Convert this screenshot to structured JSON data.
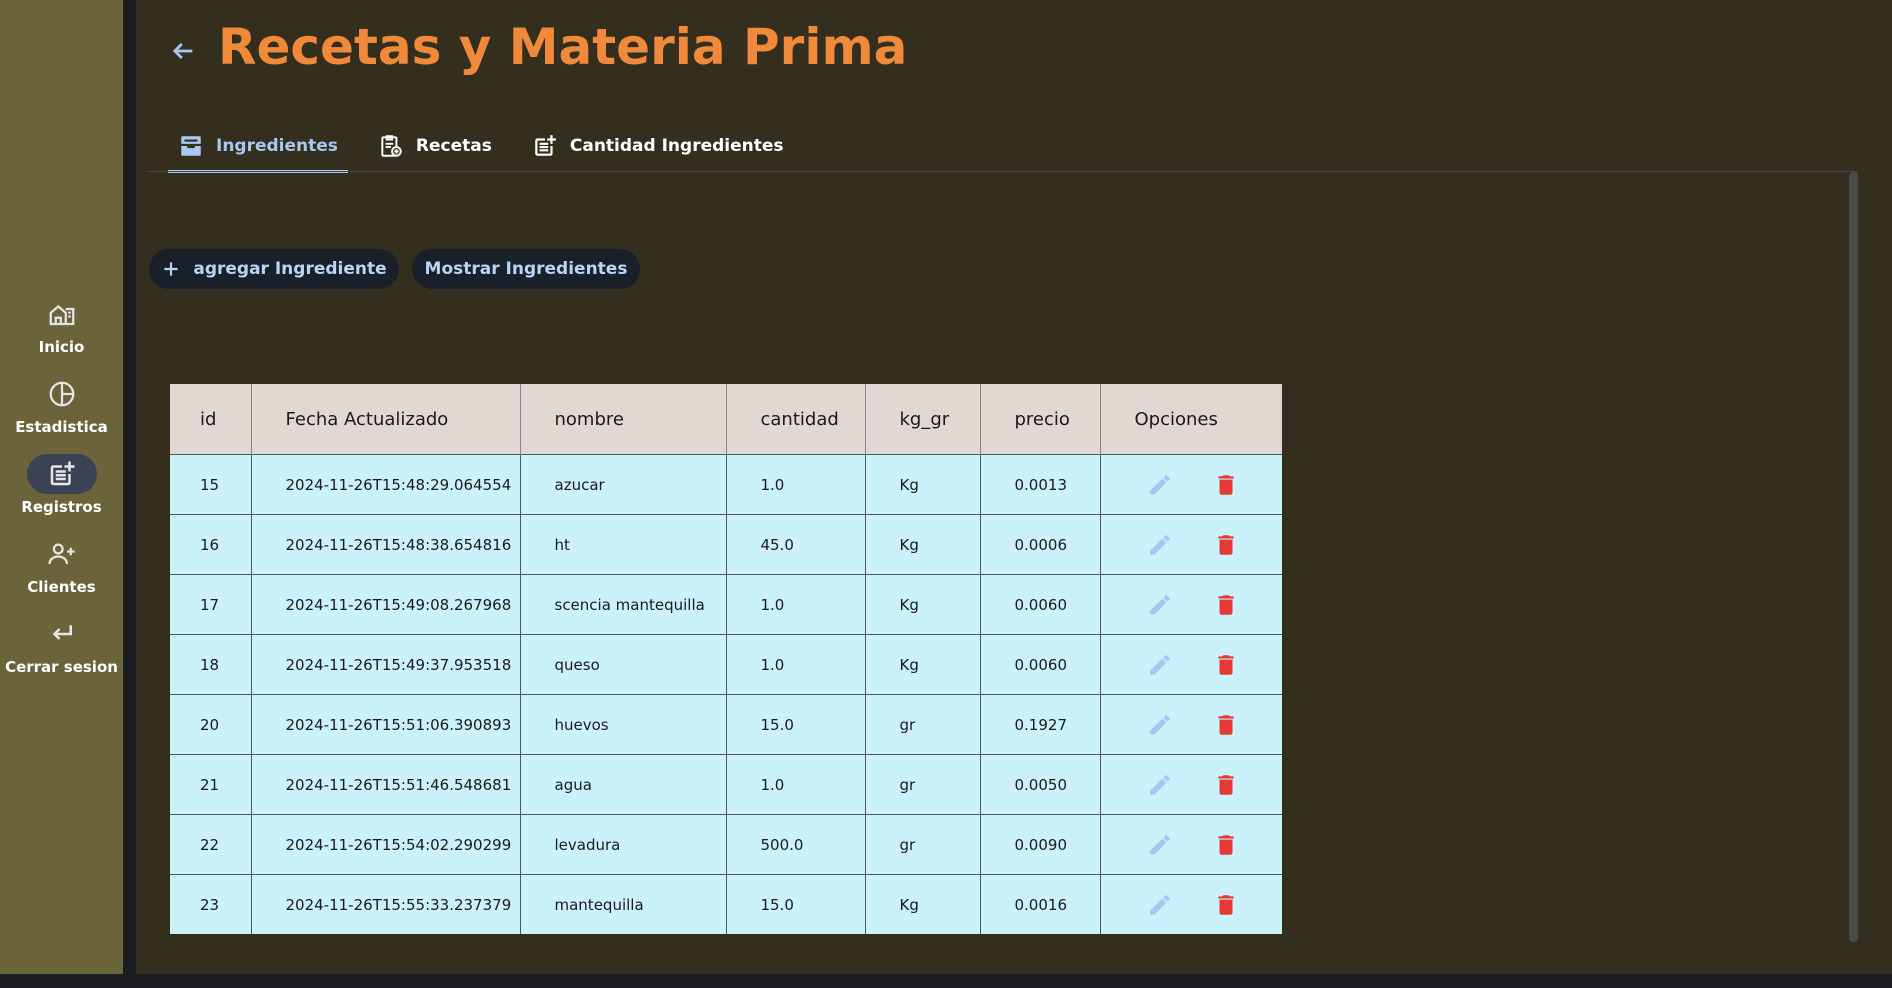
{
  "nav": {
    "items": [
      {
        "label": "Inicio",
        "icon": "home-icon"
      },
      {
        "label": "Estadistica",
        "icon": "pie-chart-icon"
      },
      {
        "label": "Registros",
        "icon": "post-add-icon",
        "active": true
      },
      {
        "label": "Clientes",
        "icon": "person-add-icon"
      },
      {
        "label": "Cerrar sesion",
        "icon": "logout-icon"
      }
    ]
  },
  "header": {
    "title": "Recetas y Materia Prima"
  },
  "tabs": [
    {
      "label": "Ingredientes",
      "icon": "inventory-icon",
      "active": true
    },
    {
      "label": "Recetas",
      "icon": "clipboard-add-icon"
    },
    {
      "label": "Cantidad Ingredientes",
      "icon": "post-add-icon"
    }
  ],
  "actions": {
    "add_label": "agregar Ingrediente",
    "show_label": "Mostrar Ingredientes"
  },
  "table": {
    "columns": [
      "id",
      "Fecha Actualizado",
      "nombre",
      "cantidad",
      "kg_gr",
      "precio",
      "Opciones"
    ],
    "rows": [
      [
        "15",
        "2024-11-26T15:48:29.064554",
        "azucar",
        "1.0",
        "Kg",
        "0.0013"
      ],
      [
        "16",
        "2024-11-26T15:48:38.654816",
        "ht",
        "45.0",
        "Kg",
        "0.0006"
      ],
      [
        "17",
        "2024-11-26T15:49:08.267968",
        "scencia mantequilla",
        "1.0",
        "Kg",
        "0.0060"
      ],
      [
        "18",
        "2024-11-26T15:49:37.953518",
        "queso",
        "1.0",
        "Kg",
        "0.0060"
      ],
      [
        "20",
        "2024-11-26T15:51:06.390893",
        "huevos",
        "15.0",
        "gr",
        "0.1927"
      ],
      [
        "21",
        "2024-11-26T15:51:46.548681",
        "agua",
        "1.0",
        "gr",
        "0.0050"
      ],
      [
        "22",
        "2024-11-26T15:54:02.290299",
        "levadura",
        "500.0",
        "gr",
        "0.0090"
      ],
      [
        "23",
        "2024-11-26T15:55:33.237379",
        "mantequilla",
        "15.0",
        "Kg",
        "0.0016"
      ]
    ]
  },
  "colors": {
    "title": "#f08a3a",
    "accent": "#a8c8f0",
    "sidebar": "#6b6339",
    "main_bg": "#332e1e",
    "row_bg": "#cbf2fb",
    "header_bg": "#e2d8d3",
    "delete": "#e53935",
    "edit": "#a9c4f2"
  }
}
